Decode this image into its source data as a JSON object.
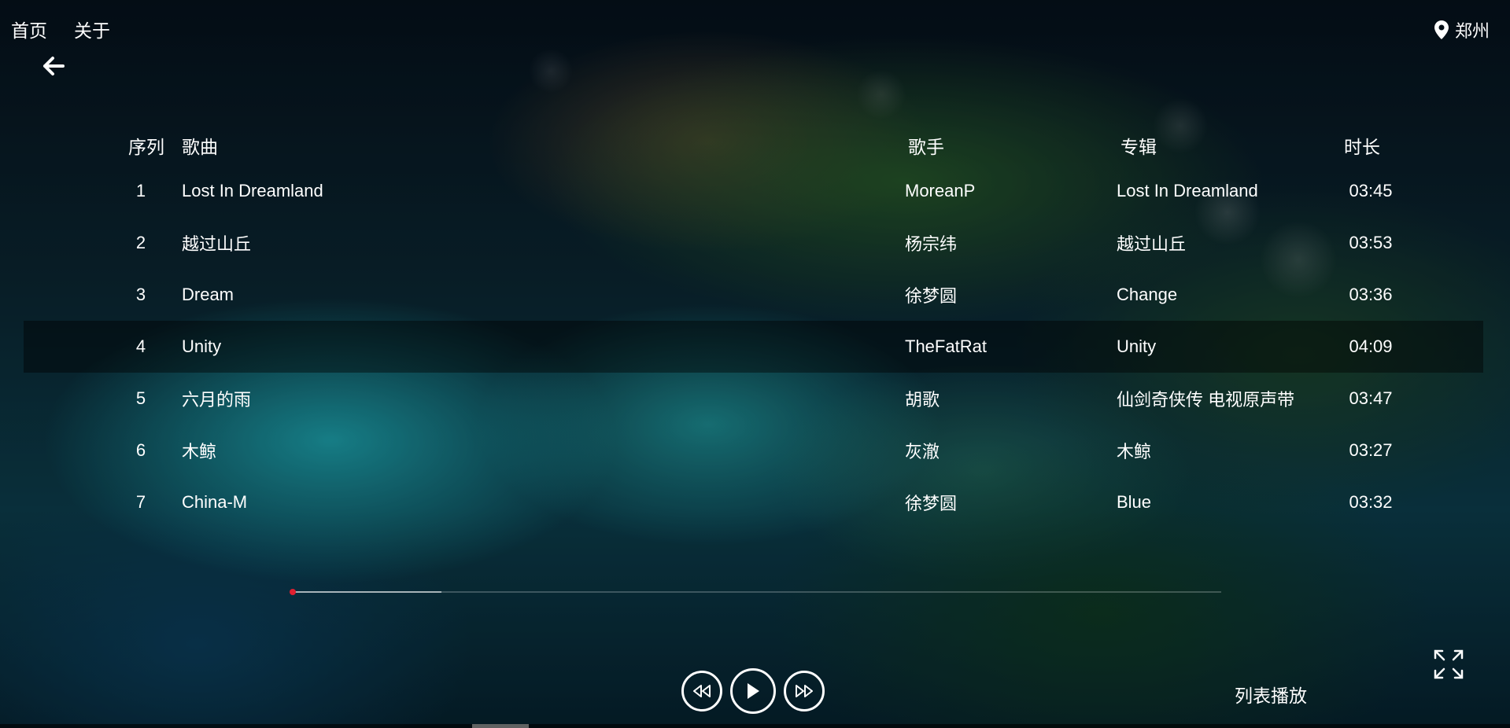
{
  "nav": {
    "home": "首页",
    "about": "关于",
    "location": "郑州"
  },
  "table": {
    "headers": {
      "index": "序列",
      "title": "歌曲",
      "artist": "歌手",
      "album": "专辑",
      "duration": "时长"
    },
    "rows": [
      {
        "index": "1",
        "title": "Lost In Dreamland",
        "artist": "MoreanP",
        "album": "Lost In Dreamland",
        "duration": "03:45"
      },
      {
        "index": "2",
        "title": "越过山丘",
        "artist": "杨宗纬",
        "album": "越过山丘",
        "duration": "03:53"
      },
      {
        "index": "3",
        "title": "Dream",
        "artist": "徐梦圆",
        "album": "Change",
        "duration": "03:36"
      },
      {
        "index": "4",
        "title": "Unity",
        "artist": "TheFatRat",
        "album": "Unity",
        "duration": "04:09"
      },
      {
        "index": "5",
        "title": "六月的雨",
        "artist": "胡歌",
        "album": "仙剑奇侠传 电视原声带",
        "duration": "03:47"
      },
      {
        "index": "6",
        "title": "木鲸",
        "artist": "灰澈",
        "album": "木鲸",
        "duration": "03:27"
      },
      {
        "index": "7",
        "title": "China-M",
        "artist": "徐梦圆",
        "album": "Blue",
        "duration": "03:32"
      }
    ],
    "highlighted_index": 4
  },
  "player": {
    "progress_fraction": 0.0,
    "buffered_fraction": 0.16,
    "play_mode": "列表播放",
    "accent_color": "#e02030"
  },
  "icons": {
    "back": "arrow-left-icon",
    "location": "map-pin-icon",
    "prev": "rewind-icon",
    "play": "play-icon",
    "next": "fast-forward-icon",
    "fullscreen": "expand-icon"
  }
}
